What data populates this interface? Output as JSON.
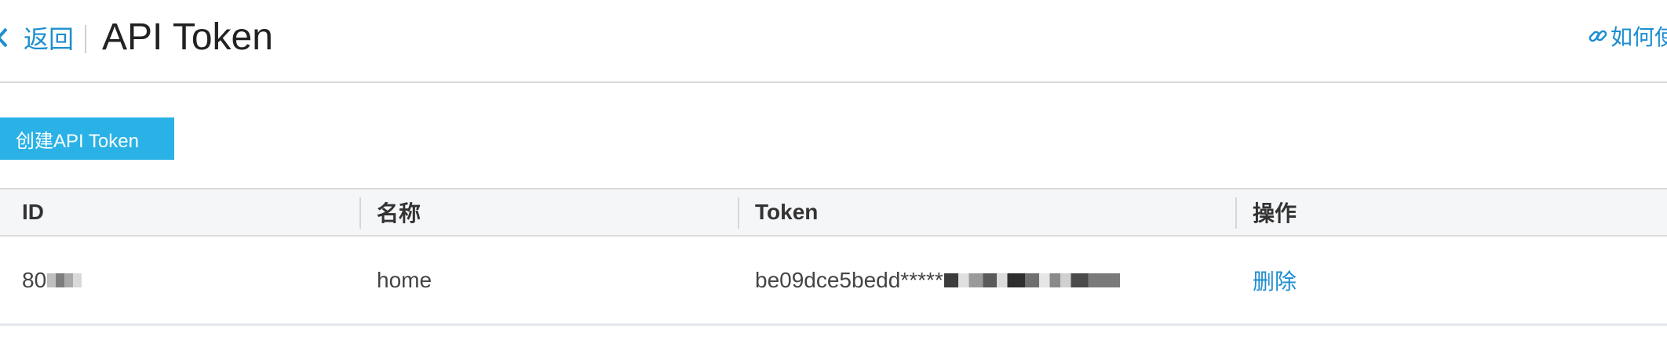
{
  "header": {
    "back_label": "返回",
    "title": "API Token",
    "help_label": "如何使用"
  },
  "toolbar": {
    "create_label": "创建API Token"
  },
  "table": {
    "columns": [
      "ID",
      "名称",
      "Token",
      "操作"
    ],
    "rows": [
      {
        "id": "80",
        "name": "home",
        "token": "be09dce5bedd*****",
        "action": "删除"
      }
    ]
  },
  "colors": {
    "accent": "#1d8ed0",
    "button": "#2ab2e6",
    "header_bg": "#f5f6f8"
  },
  "icons": {
    "back": "chevron-left-icon",
    "help": "link-icon"
  }
}
